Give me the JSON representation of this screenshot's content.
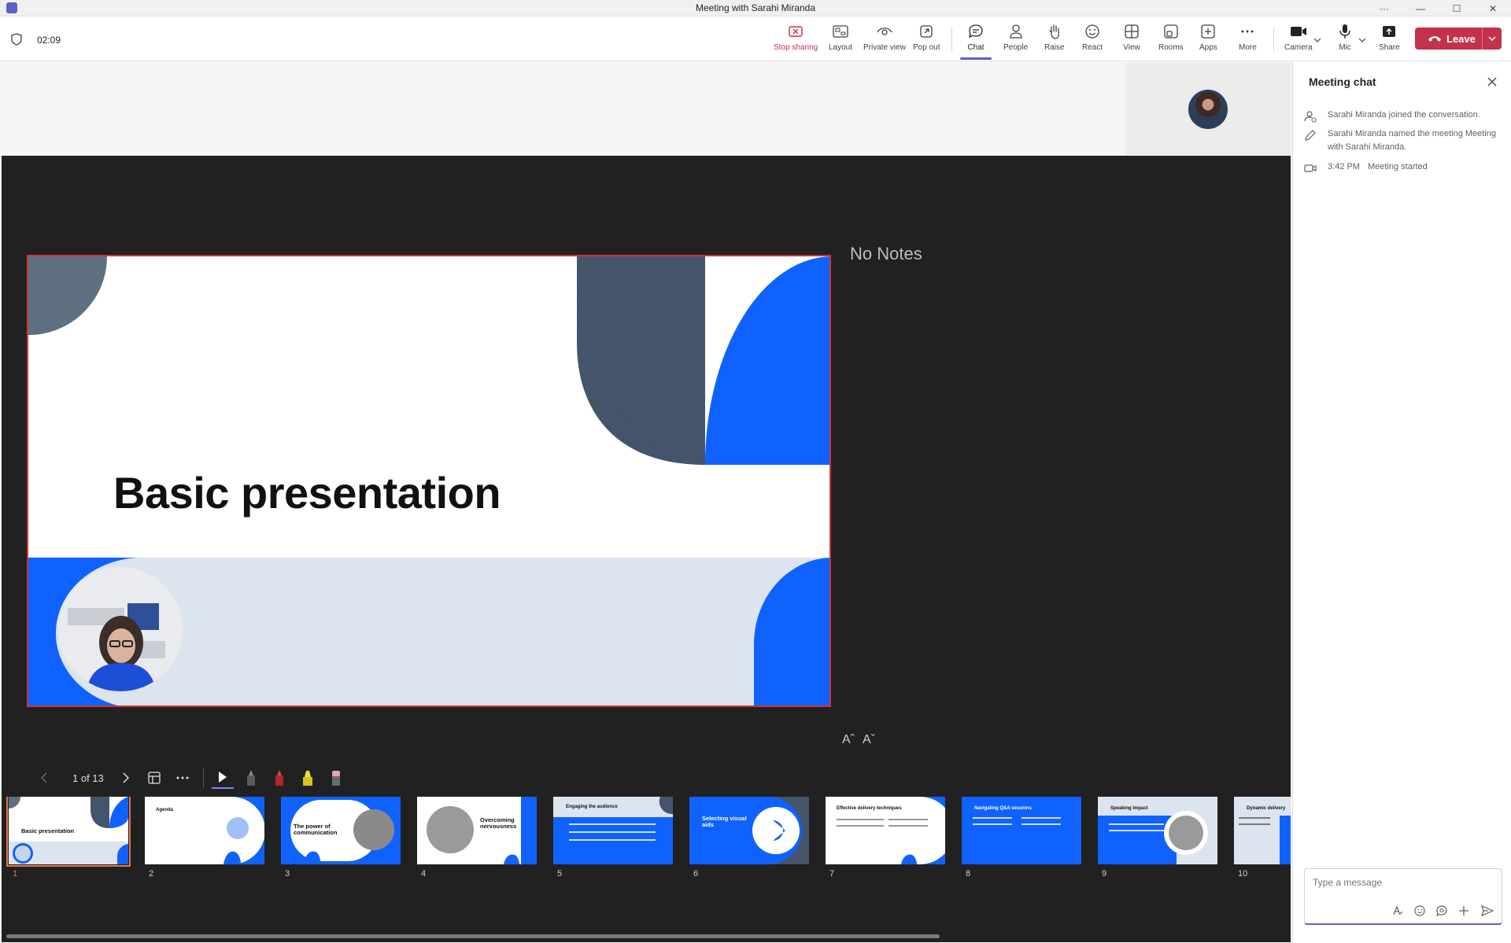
{
  "window": {
    "title": "Meeting with Sarahi Miranda"
  },
  "toolbar": {
    "timer": "02:09",
    "buttons": {
      "stop_sharing": "Stop sharing",
      "layout": "Layout",
      "private_view": "Private view",
      "pop_out": "Pop out",
      "chat": "Chat",
      "people": "People",
      "raise": "Raise",
      "react": "React",
      "view": "View",
      "rooms": "Rooms",
      "apps": "Apps",
      "more": "More",
      "camera": "Camera",
      "mic": "Mic",
      "share": "Share",
      "leave": "Leave"
    }
  },
  "presenter": {
    "notes": "No Notes",
    "font_increase": "Aˆ",
    "font_decrease": "Aˇ",
    "page_indicator": "1 of 13",
    "slide": {
      "title": "Basic presentation"
    },
    "thumbnails": [
      {
        "num": "1",
        "title": "Basic presentation"
      },
      {
        "num": "2",
        "title": "Agenda"
      },
      {
        "num": "3",
        "title": "The power of communication"
      },
      {
        "num": "4",
        "title": "Overcoming nervousness"
      },
      {
        "num": "5",
        "title": "Engaging the audience"
      },
      {
        "num": "6",
        "title": "Selecting visual aids"
      },
      {
        "num": "7",
        "title": "Effective delivery techniques"
      },
      {
        "num": "8",
        "title": "Navigating Q&A sessions"
      },
      {
        "num": "9",
        "title": "Speaking impact"
      },
      {
        "num": "10",
        "title": "Dynamic delivery"
      }
    ]
  },
  "chat": {
    "header": "Meeting chat",
    "messages": [
      {
        "text": "Sarahi Miranda joined the conversation."
      },
      {
        "text": "Sarahi Miranda named the meeting Meeting with Sarahi Miranda."
      },
      {
        "time": "3:42 PM",
        "text": "Meeting started"
      }
    ],
    "composer_placeholder": "Type a message"
  },
  "colors": {
    "accent": "#5b5fc7",
    "leave": "#c4314b",
    "slide_blue": "#0f62fe",
    "slide_slate": "#44546a"
  }
}
